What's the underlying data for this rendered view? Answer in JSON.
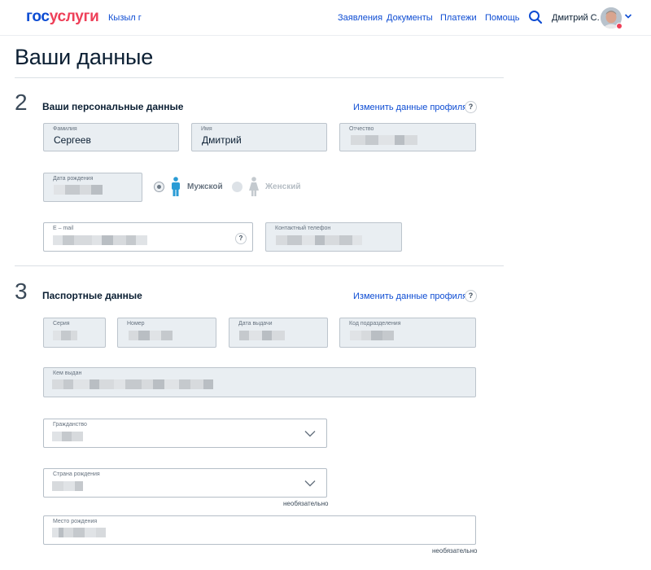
{
  "header": {
    "logo_gos": "гос",
    "logo_uslugi": "услуги",
    "city": "Кызыл г",
    "nav": [
      "Заявления",
      "Документы",
      "Платежи",
      "Помощь"
    ],
    "user_name": "Дмитрий С."
  },
  "page": {
    "title": "Ваши данные"
  },
  "personal": {
    "number": "2",
    "title": "Ваши персональные данные",
    "edit_link": "Изменить данные профиля",
    "help": "?",
    "fields": {
      "last_name": {
        "label": "Фамилия",
        "value": "Сергеев"
      },
      "first_name": {
        "label": "Имя",
        "value": "Дмитрий"
      },
      "patronymic": {
        "label": "Отчество"
      },
      "birth_date": {
        "label": "Дата рождения"
      },
      "email": {
        "label": "E – mail"
      },
      "phone": {
        "label": "Контактный телефон"
      }
    },
    "gender": {
      "male": "Мужской",
      "female": "Женский",
      "selected": "male"
    }
  },
  "passport": {
    "number": "3",
    "title": "Паспортные данные",
    "edit_link": "Изменить данные профиля",
    "help": "?",
    "fields": {
      "series": {
        "label": "Серия"
      },
      "doc_number": {
        "label": "Номер"
      },
      "issue_date": {
        "label": "Дата выдачи"
      },
      "division_code": {
        "label": "Код подразделения"
      },
      "issued_by": {
        "label": "Кем выдан"
      },
      "citizenship": {
        "label": "Гражданство"
      },
      "birth_country": {
        "label": "Страна рождения",
        "note": "необязательно"
      },
      "birth_place": {
        "label": "Место рождения",
        "note": "необязательно"
      }
    }
  },
  "colors": {
    "brand_blue": "#0d4cd3",
    "brand_red": "#ee3f58",
    "male_selected": "#2a9bd5",
    "female_inactive": "#c4cacf"
  },
  "icons": [
    "search-icon",
    "chevron-down-icon",
    "help-icon",
    "male-icon",
    "female-icon"
  ]
}
